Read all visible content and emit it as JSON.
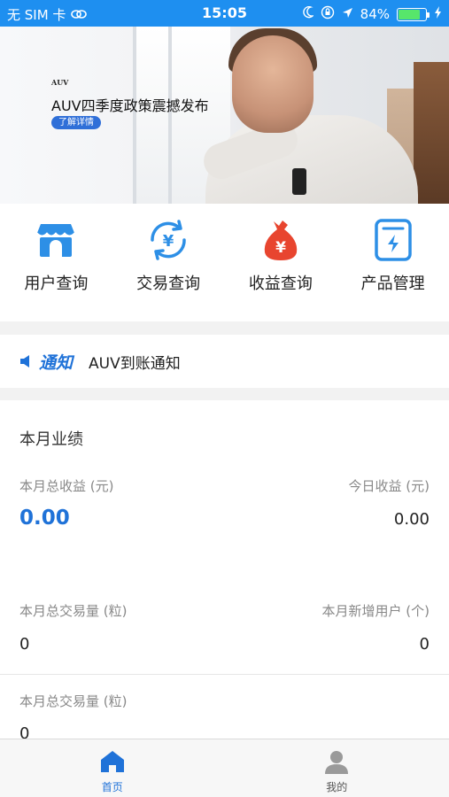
{
  "status_bar": {
    "carrier": "无 SIM 卡",
    "time": "15:05",
    "battery_percent": "84%",
    "battery_level": 0.84
  },
  "banner": {
    "logo": "AUV",
    "title": "AUV四季度政策震撼发布",
    "button": "了解详情"
  },
  "quick_actions": [
    {
      "label": "用户查询",
      "icon": "storefront-icon"
    },
    {
      "label": "交易查询",
      "icon": "yen-refresh-icon"
    },
    {
      "label": "收益查询",
      "icon": "money-bag-icon"
    },
    {
      "label": "产品管理",
      "icon": "device-card-icon"
    }
  ],
  "notice": {
    "brand": "通知",
    "text": "AUV到账通知"
  },
  "performance": {
    "title": "本月业绩",
    "month_income_label": "本月总收益 (元)",
    "month_income_value": "0.00",
    "today_income_label": "今日收益 (元)",
    "today_income_value": "0.00",
    "month_volume_label": "本月总交易量 (粒)",
    "month_volume_value": "0",
    "month_new_users_label": "本月新增用户 (个)",
    "month_new_users_value": "0",
    "month_volume_label_2": "本月总交易量 (粒)",
    "month_volume_value_2": "0"
  },
  "tabbar": {
    "home": "首页",
    "mine": "我的"
  },
  "colors": {
    "accent": "#1f72d8",
    "status_bar": "#1e8ff0",
    "money_bag": "#e8452f"
  }
}
